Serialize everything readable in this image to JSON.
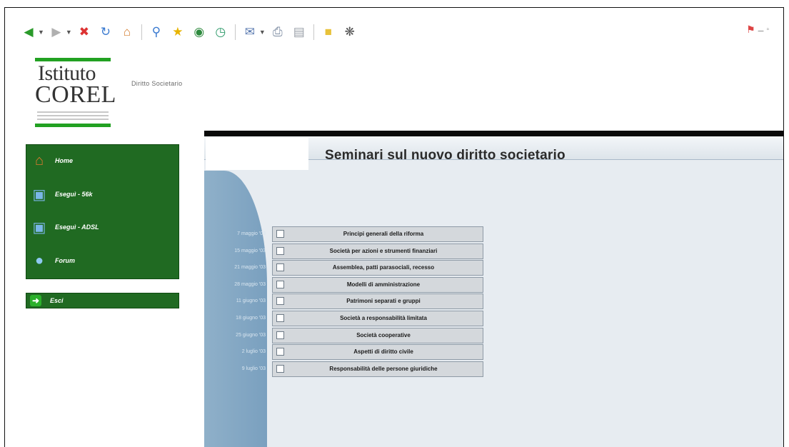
{
  "toolbar": {
    "icons": [
      "back-icon",
      "forward-icon",
      "stop-icon",
      "refresh-icon",
      "home-icon",
      "search-icon",
      "favorites-icon",
      "media-icon",
      "history-icon",
      "mail-icon",
      "print-icon",
      "edit-icon",
      "folder-icon",
      "settings-icon"
    ]
  },
  "header": {
    "logo_line1": "Istituto",
    "logo_line2": "COREL",
    "section_label": "Diritto Societario"
  },
  "sidebar": {
    "items": [
      {
        "label": "Home",
        "icon": "home-icon"
      },
      {
        "label": "Eseguì - 56k",
        "icon": "computer-icon"
      },
      {
        "label": "Eseguì - ADSL",
        "icon": "computer-icon"
      },
      {
        "label": "Forum",
        "icon": "forum-icon"
      }
    ],
    "exit_label": "Esci"
  },
  "main": {
    "title": "Seminari sul nuovo diritto societario",
    "rows": [
      {
        "date": "7 maggio '03",
        "label": "Principi generali della riforma"
      },
      {
        "date": "15 maggio '03",
        "label": "Società per azioni e strumenti finanziari"
      },
      {
        "date": "21 maggio '03",
        "label": "Assemblea, patti parasociali, recesso"
      },
      {
        "date": "28 maggio '03",
        "label": "Modelli di amministrazione"
      },
      {
        "date": "11 giugno '03",
        "label": "Patrimoni separati e gruppi"
      },
      {
        "date": "18 giugno '03",
        "label": "Società a responsabilità limitata"
      },
      {
        "date": "25 giugno '03",
        "label": "Società cooperative"
      },
      {
        "date": "2 luglio '03",
        "label": "Aspetti di diritto civile"
      },
      {
        "date": "9 luglio '03",
        "label": "Responsabilità delle persone giuridiche"
      }
    ]
  },
  "colors": {
    "sidebar_green": "#206a22",
    "logo_green": "#22a122",
    "rail_blue": "#8fb0c9",
    "panel_bg": "#e7ecf1"
  }
}
